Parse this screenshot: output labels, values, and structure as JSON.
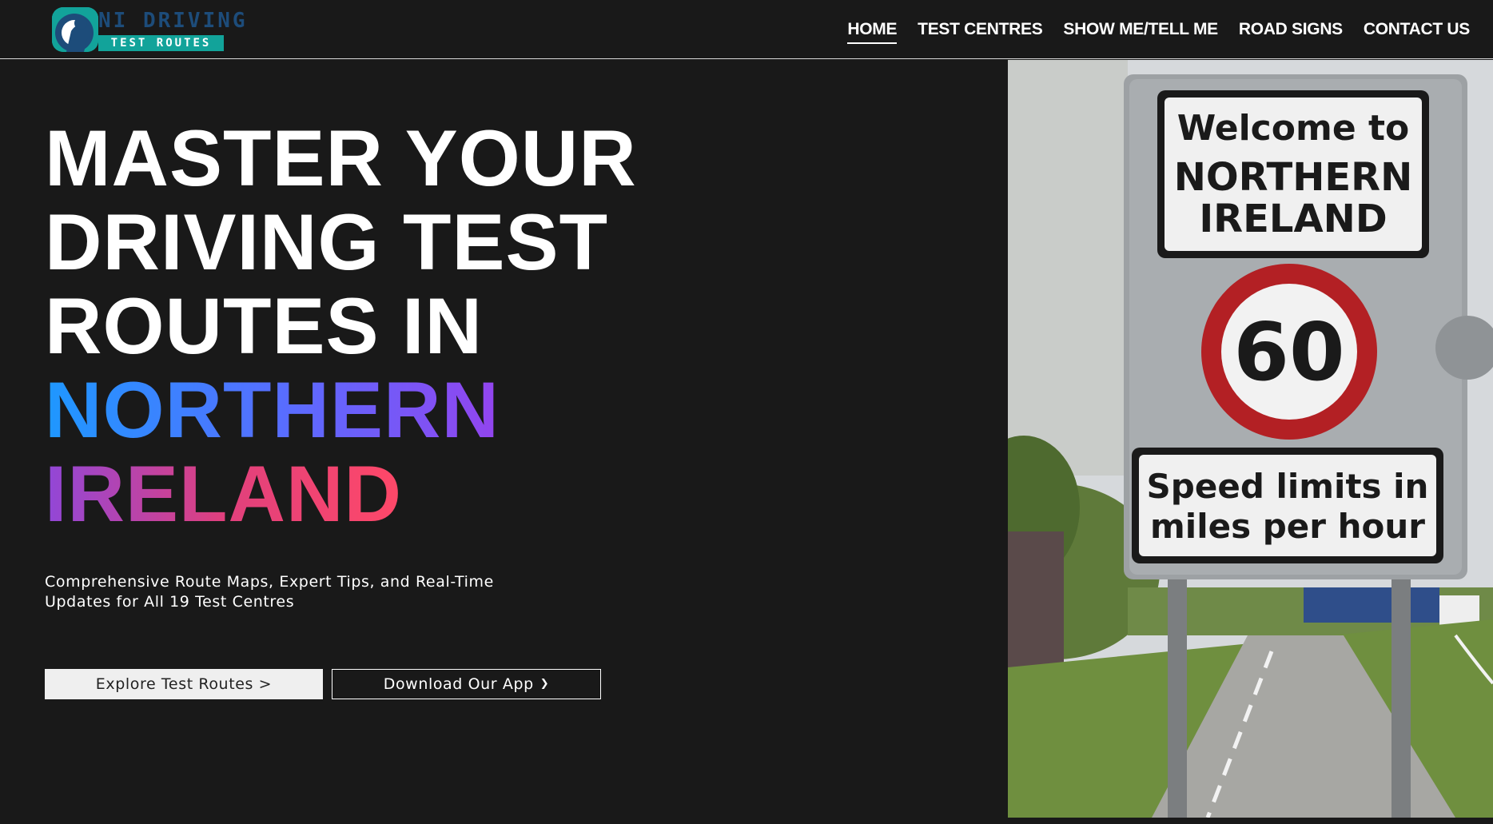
{
  "header": {
    "logo": {
      "title": "NI DRIVING",
      "subtitle": "TEST ROUTES",
      "icon": "driver-silhouette-icon",
      "accent_color": "#12a39a",
      "title_color": "#1d4c7a"
    },
    "nav": [
      {
        "label": "HOME",
        "active": true
      },
      {
        "label": "TEST CENTRES",
        "active": false
      },
      {
        "label": "SHOW ME/TELL ME",
        "active": false
      },
      {
        "label": "ROAD SIGNS",
        "active": false
      },
      {
        "label": "CONTACT US",
        "active": false
      }
    ]
  },
  "hero": {
    "title_lines": [
      "MASTER YOUR",
      "DRIVING TEST",
      "ROUTES IN"
    ],
    "title_highlight_1": "NORTHERN",
    "title_highlight_2": "IRELAND",
    "highlight_gradient_1": [
      "#1e98ff",
      "#5b6bff",
      "#9344ee"
    ],
    "highlight_gradient_2": [
      "#9147d8",
      "#e0407d",
      "#ff4868"
    ],
    "subtitle": "Comprehensive Route Maps, Expert Tips, and Real-Time Updates for All 19 Test Centres",
    "buttons": {
      "explore_label": "Explore Test Routes >",
      "download_label": "Download Our App",
      "download_icon": "chevron-down-icon"
    }
  },
  "photo": {
    "sign_welcome_line1": "Welcome to",
    "sign_welcome_line2": "NORTHERN",
    "sign_welcome_line3": "IRELAND",
    "speed_limit": "60",
    "sign_speed_line1": "Speed limits in",
    "sign_speed_line2": "miles per hour"
  },
  "colors": {
    "background": "#191919",
    "text": "#ffffff",
    "button_primary_bg": "#efefef"
  }
}
